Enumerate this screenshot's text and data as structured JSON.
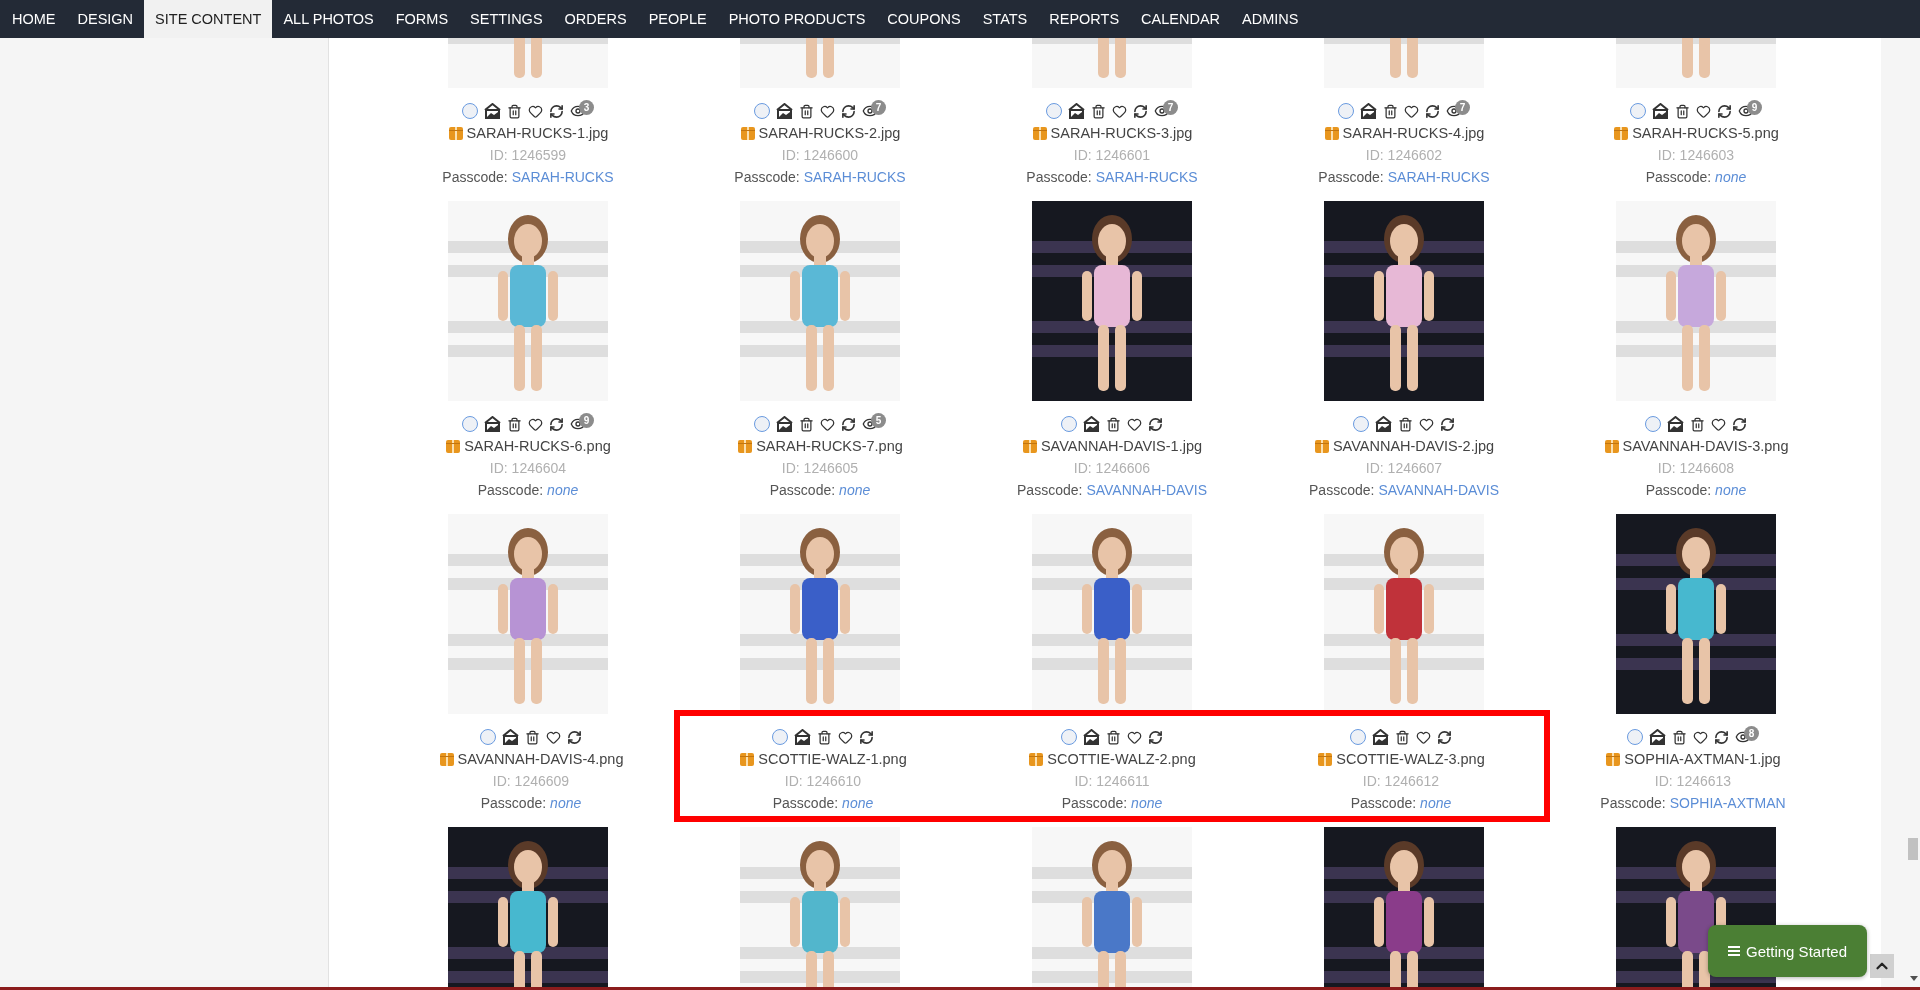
{
  "nav": [
    {
      "label": "HOME",
      "selected": false
    },
    {
      "label": "DESIGN",
      "selected": false
    },
    {
      "label": "SITE CONTENT",
      "selected": true
    },
    {
      "label": "ALL PHOTOS",
      "selected": false
    },
    {
      "label": "FORMS",
      "selected": false
    },
    {
      "label": "SETTINGS",
      "selected": false
    },
    {
      "label": "ORDERS",
      "selected": false
    },
    {
      "label": "PEOPLE",
      "selected": false
    },
    {
      "label": "PHOTO PRODUCTS",
      "selected": false
    },
    {
      "label": "COUPONS",
      "selected": false
    },
    {
      "label": "STATS",
      "selected": false
    },
    {
      "label": "REPORTS",
      "selected": false
    },
    {
      "label": "CALENDAR",
      "selected": false
    },
    {
      "label": "ADMINS",
      "selected": false
    }
  ],
  "cards": [
    {
      "filename": "SARAH-RUCKS-1.jpg",
      "id": "ID: 1246599",
      "passcode_label": "Passcode:",
      "passcode": "SARAH-RUCKS",
      "passcode_linked": true,
      "views": "3",
      "selected": false,
      "highlighted": false
    },
    {
      "filename": "SARAH-RUCKS-2.jpg",
      "id": "ID: 1246600",
      "passcode_label": "Passcode:",
      "passcode": "SARAH-RUCKS",
      "passcode_linked": true,
      "views": "7",
      "selected": false,
      "highlighted": false
    },
    {
      "filename": "SARAH-RUCKS-3.jpg",
      "id": "ID: 1246601",
      "passcode_label": "Passcode:",
      "passcode": "SARAH-RUCKS",
      "passcode_linked": true,
      "views": "7",
      "selected": false,
      "highlighted": false
    },
    {
      "filename": "SARAH-RUCKS-4.jpg",
      "id": "ID: 1246602",
      "passcode_label": "Passcode:",
      "passcode": "SARAH-RUCKS",
      "passcode_linked": true,
      "views": "7",
      "selected": false,
      "highlighted": false
    },
    {
      "filename": "SARAH-RUCKS-5.png",
      "id": "ID: 1246603",
      "passcode_label": "Passcode:",
      "passcode": "none",
      "passcode_linked": false,
      "views": "9",
      "selected": false,
      "highlighted": false
    },
    {
      "filename": "SARAH-RUCKS-6.png",
      "id": "ID: 1246604",
      "passcode_label": "Passcode:",
      "passcode": "none",
      "passcode_linked": false,
      "views": "9",
      "selected": false,
      "highlighted": false
    },
    {
      "filename": "SARAH-RUCKS-7.png",
      "id": "ID: 1246605",
      "passcode_label": "Passcode:",
      "passcode": "none",
      "passcode_linked": false,
      "views": "5",
      "selected": false,
      "highlighted": false
    },
    {
      "filename": "SAVANNAH-DAVIS-1.jpg",
      "id": "ID: 1246606",
      "passcode_label": "Passcode:",
      "passcode": "SAVANNAH-DAVIS",
      "passcode_linked": true,
      "selected": false,
      "highlighted": false
    },
    {
      "filename": "SAVANNAH-DAVIS-2.jpg",
      "id": "ID: 1246607",
      "passcode_label": "Passcode:",
      "passcode": "SAVANNAH-DAVIS",
      "passcode_linked": true,
      "selected": false,
      "highlighted": false
    },
    {
      "filename": "SAVANNAH-DAVIS-3.png",
      "id": "ID: 1246608",
      "passcode_label": "Passcode:",
      "passcode": "none",
      "passcode_linked": false,
      "selected": false,
      "highlighted": false
    },
    {
      "filename": "SAVANNAH-DAVIS-4.png",
      "id": "ID: 1246609",
      "passcode_label": "Passcode:",
      "passcode": "none",
      "passcode_linked": false,
      "selected": false,
      "highlighted": false
    },
    {
      "filename": "SCOTTIE-WALZ-1.png",
      "id": "ID: 1246610",
      "passcode_label": "Passcode:",
      "passcode": "none",
      "passcode_linked": false,
      "selected": false,
      "highlighted": true
    },
    {
      "filename": "SCOTTIE-WALZ-2.png",
      "id": "ID: 1246611",
      "passcode_label": "Passcode:",
      "passcode": "none",
      "passcode_linked": false,
      "selected": false,
      "highlighted": true
    },
    {
      "filename": "SCOTTIE-WALZ-3.png",
      "id": "ID: 1246612",
      "passcode_label": "Passcode:",
      "passcode": "none",
      "passcode_linked": false,
      "selected": false,
      "highlighted": true
    },
    {
      "filename": "SOPHIA-AXTMAN-1.jpg",
      "id": "ID: 1246613",
      "passcode_label": "Passcode:",
      "passcode": "SOPHIA-AXTMAN",
      "passcode_linked": true,
      "views": "8",
      "selected": false,
      "highlighted": false
    },
    {
      "kind": "picture"
    },
    {
      "kind": "picture"
    },
    {
      "kind": "picture"
    },
    {
      "kind": "picture"
    },
    {
      "kind": "picture"
    }
  ],
  "help_button": {
    "label": "Getting Started"
  }
}
